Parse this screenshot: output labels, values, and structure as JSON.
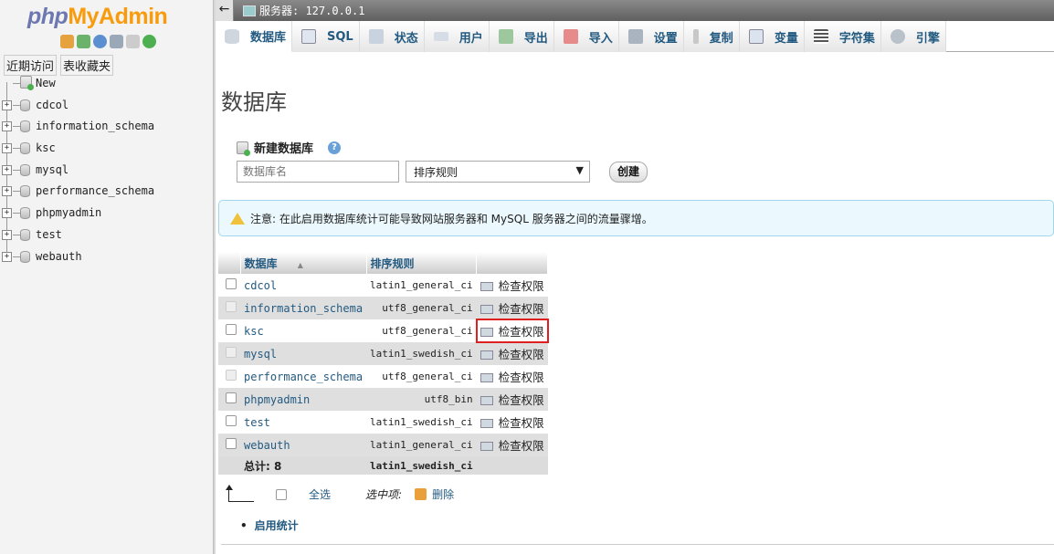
{
  "logo": {
    "php": "php",
    "my": "MyAdmin"
  },
  "nav": {
    "tabs": [
      "近期访问",
      "表收藏夹"
    ],
    "new_label": "New",
    "databases": [
      "cdcol",
      "information_schema",
      "ksc",
      "mysql",
      "performance_schema",
      "phpmyadmin",
      "test",
      "webauth"
    ]
  },
  "topbar": {
    "server": "服务器: 127.0.0.1",
    "collapse": "←"
  },
  "menu": [
    "数据库",
    "SQL",
    "状态",
    "用户",
    "导出",
    "导入",
    "设置",
    "复制",
    "变量",
    "字符集",
    "引擎"
  ],
  "page": {
    "title": "数据库",
    "new_db_label": "新建数据库",
    "help": "?",
    "db_name_placeholder": "数据库名",
    "collation_default": "排序规则",
    "create_button": "创建"
  },
  "notice": "注意: 在此启用数据库统计可能导致网站服务器和 MySQL 服务器之间的流量骤增。",
  "table": {
    "headers": {
      "database": "数据库",
      "sort": "▲",
      "collation": "排序规则"
    },
    "rows": [
      {
        "name": "cdcol",
        "collation": "latin1_general_ci",
        "action": "检查权限"
      },
      {
        "name": "information_schema",
        "collation": "utf8_general_ci",
        "action": "检查权限"
      },
      {
        "name": "ksc",
        "collation": "utf8_general_ci",
        "action": "检查权限"
      },
      {
        "name": "mysql",
        "collation": "latin1_swedish_ci",
        "action": "检查权限"
      },
      {
        "name": "performance_schema",
        "collation": "utf8_general_ci",
        "action": "检查权限"
      },
      {
        "name": "phpmyadmin",
        "collation": "utf8_bin",
        "action": "检查权限"
      },
      {
        "name": "test",
        "collation": "latin1_swedish_ci",
        "action": "检查权限"
      },
      {
        "name": "webauth",
        "collation": "latin1_general_ci",
        "action": "检查权限"
      }
    ],
    "total_label": "总计: 8",
    "total_collation": "latin1_swedish_ci"
  },
  "footer": {
    "select_all": "全选",
    "with_selected": "选中项:",
    "delete": "删除",
    "enable_stats": "启用统计"
  },
  "colors": {
    "link": "#235a81",
    "highlight": "#e02020"
  }
}
